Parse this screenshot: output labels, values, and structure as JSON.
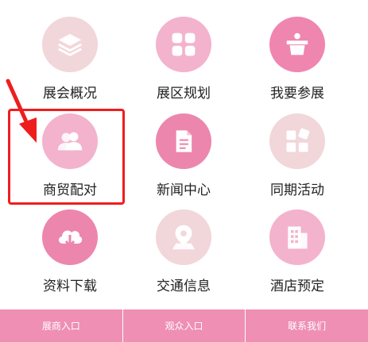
{
  "menu": [
    {
      "label": "展会概况",
      "icon": "layers-icon",
      "color": "#f1d6da"
    },
    {
      "label": "展区规划",
      "icon": "grid-squares-icon",
      "color": "#f3b3cc"
    },
    {
      "label": "我要参展",
      "icon": "podium-icon",
      "color": "#ef86b0"
    },
    {
      "label": "商贸配对",
      "icon": "people-icon",
      "color": "#f3b3cc"
    },
    {
      "label": "新闻中心",
      "icon": "document-icon",
      "color": "#ec86ad"
    },
    {
      "label": "同期活动",
      "icon": "squares-icon",
      "color": "#f1d6da"
    },
    {
      "label": "资料下载",
      "icon": "cloud-download-icon",
      "color": "#ec86ad"
    },
    {
      "label": "交通信息",
      "icon": "map-pin-icon",
      "color": "#f1d6da"
    },
    {
      "label": "酒店预定",
      "icon": "building-icon",
      "color": "#f3b3cc"
    }
  ],
  "footer": {
    "buttons": [
      "展商入口",
      "观众入口",
      "联系我们"
    ],
    "color": "#ee8fb3"
  }
}
